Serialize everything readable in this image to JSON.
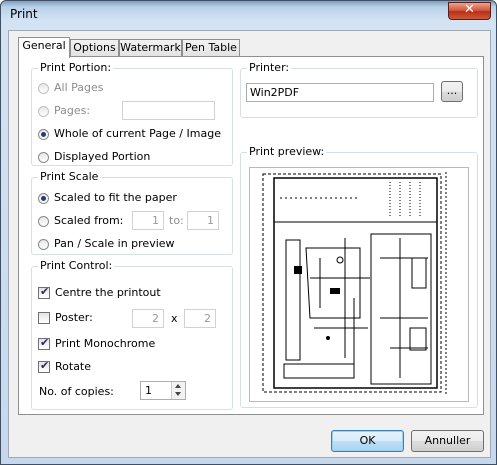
{
  "window": {
    "title": "Print",
    "close_symbol": "✕"
  },
  "tabs": [
    "General",
    "Options",
    "Watermark",
    "Pen Table"
  ],
  "portion": {
    "legend": "Print Portion:",
    "all_pages": "All Pages",
    "pages": "Pages:",
    "whole": "Whole of current Page / Image",
    "displayed": "Displayed Portion",
    "selected": "whole"
  },
  "scale": {
    "legend": "Print Scale",
    "fit": "Scaled to fit the paper",
    "from": "Scaled from:",
    "from_value": "1",
    "to_label": "to:",
    "to_value": "1",
    "pan": "Pan / Scale in preview",
    "selected": "fit"
  },
  "control": {
    "legend": "Print Control:",
    "centre": "Centre the printout",
    "poster": "Poster:",
    "poster_x": "2",
    "times": "x",
    "poster_y": "2",
    "mono": "Print Monochrome",
    "rotate": "Rotate",
    "copies_label": "No. of copies:",
    "copies": "1",
    "checked": {
      "centre": true,
      "poster": false,
      "mono": true,
      "rotate": true
    }
  },
  "printer": {
    "legend": "Printer:",
    "name": "Win2PDF",
    "browse": "..."
  },
  "preview": {
    "legend": "Print preview:"
  },
  "buttons": {
    "ok": "OK",
    "cancel": "Annuller"
  }
}
